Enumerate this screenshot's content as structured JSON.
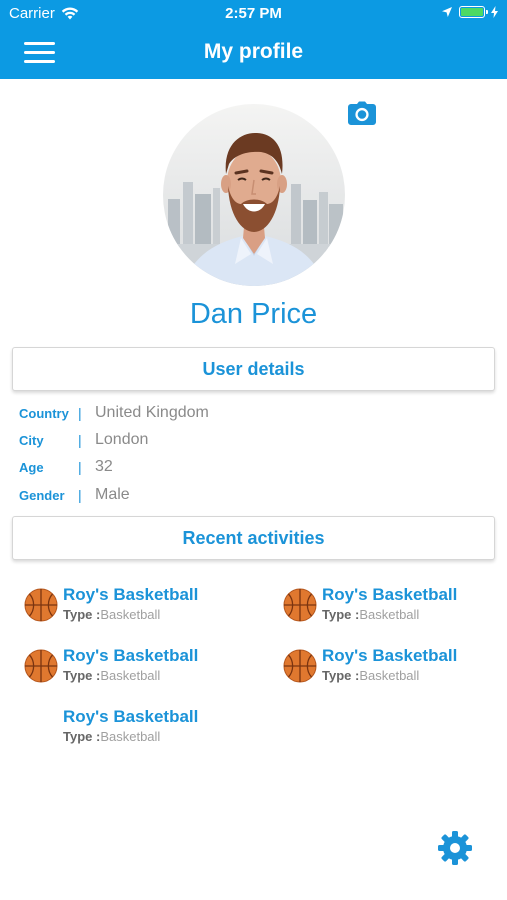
{
  "status_bar": {
    "carrier": "Carrier",
    "time": "2:57 PM"
  },
  "header": {
    "title": "My profile",
    "menu_icon": "hamburger-menu-icon"
  },
  "profile": {
    "name": "Dan Price",
    "camera_icon": "camera-icon"
  },
  "user_details": {
    "heading": "User details",
    "rows": [
      {
        "label": "Country",
        "separator": "|",
        "value": "United Kingdom"
      },
      {
        "label": "City",
        "separator": "|",
        "value": "London"
      },
      {
        "label": "Age",
        "separator": "|",
        "value": "32"
      },
      {
        "label": "Gender",
        "separator": "|",
        "value": "Male"
      }
    ]
  },
  "recent_activities": {
    "heading": "Recent activities",
    "items": [
      {
        "name": "Roy's Basketball",
        "type_label": "Type :",
        "type_value": "Basketball",
        "icon": "basketball-icon"
      },
      {
        "name": "Roy's Basketball",
        "type_label": "Type :",
        "type_value": "Basketball",
        "icon": "basketball-icon"
      },
      {
        "name": "Roy's Basketball",
        "type_label": "Type :",
        "type_value": "Basketball",
        "icon": "basketball-icon"
      },
      {
        "name": "Roy's Basketball",
        "type_label": "Type :",
        "type_value": "Basketball",
        "icon": "basketball-icon"
      },
      {
        "name": "Roy's Basketball",
        "type_label": "Type :",
        "type_value": "Basketball",
        "icon": ""
      }
    ]
  },
  "settings": {
    "icon": "gear-icon"
  },
  "colors": {
    "primary": "#0c9ae3",
    "accent_text": "#1b93d8",
    "value_text": "#8a8a8a"
  }
}
